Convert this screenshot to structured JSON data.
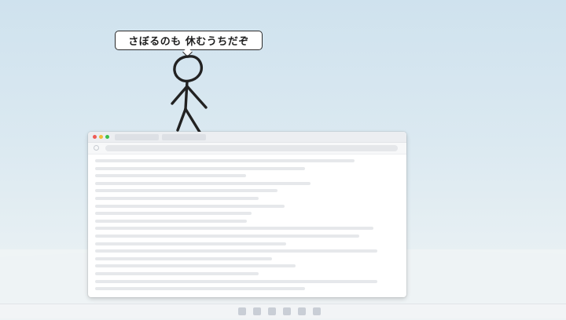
{
  "speech": {
    "text": "さぼるのも 休むうちだぞ"
  },
  "colors": {
    "sky_top": "#cfe2ee",
    "sky_bottom": "#eef3f5",
    "window_background": "#ffffff",
    "window_chrome": "#eceef1",
    "skeleton_line": "#e6e8eb",
    "stroke": "#222222",
    "traffic_red": "#ee5b55",
    "traffic_yellow": "#f2bc3a",
    "traffic_green": "#3cbf4d"
  },
  "icons": {
    "reload": "reload-icon",
    "figure": "stick-figure-icon"
  }
}
